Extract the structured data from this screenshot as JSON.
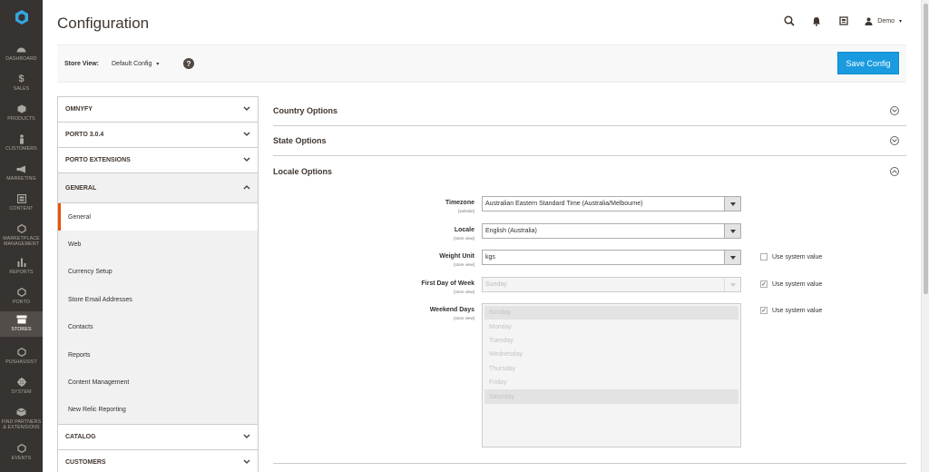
{
  "nav": {
    "items": [
      {
        "label": "DASHBOARD",
        "icon": "dashboard-icon"
      },
      {
        "label": "SALES",
        "icon": "dollar-icon"
      },
      {
        "label": "PRODUCTS",
        "icon": "cube-icon"
      },
      {
        "label": "CUSTOMERS",
        "icon": "person-icon"
      },
      {
        "label": "MARKETING",
        "icon": "megaphone-icon"
      },
      {
        "label": "CONTENT",
        "icon": "content-icon"
      },
      {
        "label": "MARKETPLACE MANAGEMENT",
        "icon": "hexagon-icon"
      },
      {
        "label": "REPORTS",
        "icon": "bar-chart-icon"
      },
      {
        "label": "PORTO",
        "icon": "hexagon-icon"
      },
      {
        "label": "STORES",
        "icon": "store-icon"
      },
      {
        "label": "PUSHASSIST",
        "icon": "hexagon-icon"
      },
      {
        "label": "SYSTEM",
        "icon": "gear-icon"
      },
      {
        "label": "FIND PARTNERS & EXTENSIONS",
        "icon": "box-icon"
      },
      {
        "label": "EVENTS",
        "icon": "hexagon-icon"
      }
    ],
    "active_index": 9
  },
  "header": {
    "title": "Configuration",
    "user": "Demo"
  },
  "store_bar": {
    "label": "Store View:",
    "value": "Default Config",
    "help": "?",
    "save_label": "Save Config"
  },
  "tabs": {
    "collapsed_top": [
      "OMNYFY",
      "PORTO 3.0.4",
      "PORTO EXTENSIONS"
    ],
    "open_group": "GENERAL",
    "items": [
      "General",
      "Web",
      "Currency Setup",
      "Store Email Addresses",
      "Contacts",
      "Reports",
      "Content Management",
      "New Relic Reporting"
    ],
    "active_item": "General",
    "collapsed_bottom": [
      "CATALOG",
      "CUSTOMERS"
    ]
  },
  "sections": {
    "country": "Country Options",
    "state": "State Options",
    "locale": "Locale Options"
  },
  "fields": {
    "timezone": {
      "label": "Timezone",
      "scope": "[website]",
      "value": "Australian Eastern Standard Time (Australia/Melbourne)"
    },
    "locale": {
      "label": "Locale",
      "scope": "[store view]",
      "value": "English (Australia)"
    },
    "weight_unit": {
      "label": "Weight Unit",
      "scope": "[store view]",
      "value": "kgs",
      "use_system_value": false
    },
    "first_day": {
      "label": "First Day of Week",
      "scope": "[store view]",
      "value": "Sunday",
      "use_system_value": true
    },
    "weekend_days": {
      "label": "Weekend Days",
      "scope": "[store view]",
      "options": [
        "Sunday",
        "Monday",
        "Tuesday",
        "Wednesday",
        "Thursday",
        "Friday",
        "Saturday"
      ],
      "selected": [
        "Sunday",
        "Saturday"
      ],
      "use_system_value": true
    },
    "system_value_label": "Use system value"
  },
  "colors": {
    "nav_bg": "#373330",
    "accent_orange": "#eb5202",
    "save_button": "#1a9be0"
  }
}
